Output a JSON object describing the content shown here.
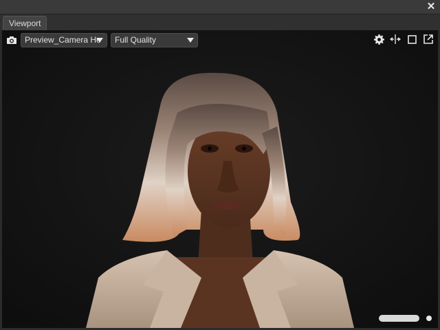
{
  "window": {
    "close_glyph": "✕"
  },
  "tab": {
    "label": "Viewport"
  },
  "toolbar": {
    "camera_icon": "camera-icon",
    "camera_select": "Preview_Camera He",
    "quality_select": "Full Quality",
    "right_icons": [
      "gear-icon",
      "fit-icon",
      "maximize-icon",
      "popout-icon"
    ]
  },
  "viewport": {
    "content": "3D render of a woman with shoulder-length ombre hair in a beige blazer",
    "background_color": "#121212"
  },
  "colors": {
    "window_bg": "#2b2b2b",
    "tab_bg": "#444444",
    "dropdown_bg": "#3a3a3a"
  }
}
